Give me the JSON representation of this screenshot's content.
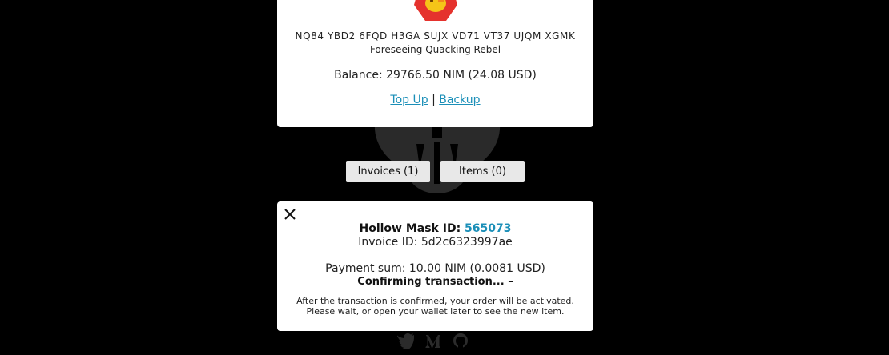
{
  "wallet": {
    "address": "NQ84 YBD2 6FQD H3GA SUJX VD71 VT37 UJQM XGMK",
    "name": "Foreseeing Quacking Rebel",
    "balance": "Balance: 29766.50 NIM (24.08 USD)",
    "top_up_label": "Top Up",
    "separator": "|",
    "backup_label": "Backup"
  },
  "tabs": {
    "invoices_label": "Invoices (1)",
    "items_label": "Items (0)"
  },
  "invoice": {
    "title_prefix": "Hollow Mask ID: ",
    "mask_id": "565073",
    "invoice_id": "Invoice ID: 5d2c6323997ae",
    "payment_sum": "Payment sum: 10.00 NIM (0.0081 USD)",
    "status": "Confirming transaction... –",
    "note_line1": "After the transaction is confirmed, your order will be activated.",
    "note_line2": "Please wait, or open your wallet later to see the new item."
  },
  "icons": {
    "avatar": "identicon-avatar",
    "close": "close-icon",
    "twitter": "twitter-icon",
    "medium": "medium-icon",
    "github": "github-icon",
    "background": "mascot-silhouette"
  },
  "colors": {
    "background": "#000000",
    "card": "#ffffff",
    "link": "#1b8fb8",
    "button": "#e8e8e8",
    "avatar_red": "#e5322d",
    "avatar_yellow": "#f5c518"
  }
}
